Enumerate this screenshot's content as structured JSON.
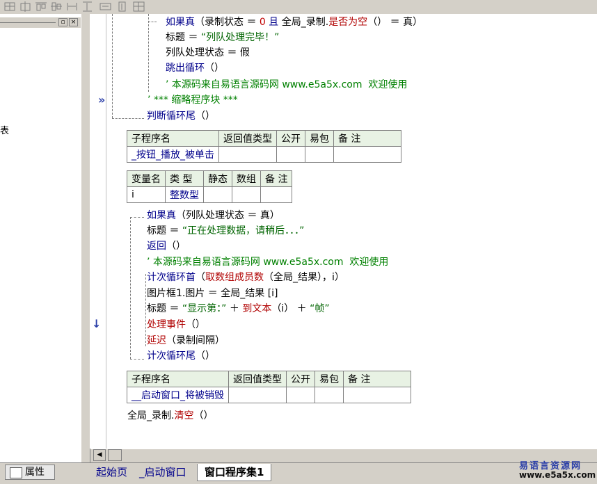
{
  "toolbar": {
    "buttons": [
      "align-left-icon",
      "align-center-icon",
      "align-top-icon",
      "align-middle-icon",
      "same-width-icon",
      "same-height-icon",
      "horizontal-space-icon",
      "vertical-space-icon",
      "center-icon"
    ]
  },
  "left_panel": {
    "min_button": "▫",
    "close_button": "×",
    "cut_text": "表",
    "properties_tab": "属性"
  },
  "code": {
    "block1": {
      "if_kw": "如果真",
      "if_cond_a": "（录制状态 ＝ ",
      "if_zero": "0",
      "if_and": " 且 ",
      "if_var": "全局_录制.",
      "if_fn": "是否为空",
      "if_cond_b": "（） ＝ 真）",
      "title_set_a": "标题 ＝ ",
      "title_str": "“列队处理完毕！”",
      "state_line": "列队处理状态 ＝ 假",
      "break_kw": "跳出循环",
      "break_paren": "（）",
      "comment_line": "’ 本源码来自易语言源码网 www.e5a5x.com  欢迎使用",
      "collapsed_block": "’ *** 缩略程序块 ***",
      "loop_end_kw": "判断循环尾",
      "loop_end_paren": "（）"
    },
    "sub1": {
      "headers": [
        "子程序名",
        "返回值类型",
        "公开",
        "易包",
        "备 注"
      ],
      "name": "_按钮_播放_被单击"
    },
    "vars1": {
      "headers": [
        "变量名",
        "类 型",
        "静态",
        "数组",
        "备 注"
      ],
      "name": "i",
      "type": "整数型"
    },
    "block2": {
      "if_kw": "如果真",
      "if_cond": "（列队处理状态 ＝ 真）",
      "title_set_a": "标题 ＝ ",
      "title_str": "“正在处理数据，请稍后．．．”",
      "return_kw": "返回",
      "return_paren": "（）",
      "comment_line": "’ 本源码来自易语言源码网 www.e5a5x.com  欢迎使用",
      "for_kw": "计次循环首",
      "for_paren_open": "（",
      "for_fn": "取数组成员数",
      "for_args": "（全局_结果），i）",
      "pic_line": "图片框1.图片 ＝ 全局_结果 [i]",
      "title2_a": "标题 ＝ ",
      "title2_str1": "“显示第：”",
      "title2_plus": " ＋ ",
      "title2_fn": "到文本",
      "title2_arg": "（i） ＋ ",
      "title2_str2": "“帧”",
      "event_fn": "处理事件",
      "event_paren": "（）",
      "delay_fn": "延迟",
      "delay_arg": "（录制间隔）",
      "for_end_kw": "计次循环尾",
      "for_end_paren": "（）"
    },
    "sub2": {
      "headers": [
        "子程序名",
        "返回值类型",
        "公开",
        "易包",
        "备 注"
      ],
      "name": "__启动窗口_将被销毁"
    },
    "last_line_var": "全局_录制.",
    "last_line_fn": "清空",
    "last_line_paren": "（）"
  },
  "gutter": {
    "collapse_marker": "»",
    "current_marker": "↓"
  },
  "tabs": [
    "起始页",
    "_启动窗口",
    "窗口程序集1"
  ],
  "watermark": {
    "line1": "易语言资源网",
    "line2": "www.e5a5x.com"
  },
  "colors": {
    "keyword": "#00008b",
    "function": "#b00000",
    "string": "#006400",
    "comment": "#008000",
    "table_header": "#e8f2e4"
  }
}
